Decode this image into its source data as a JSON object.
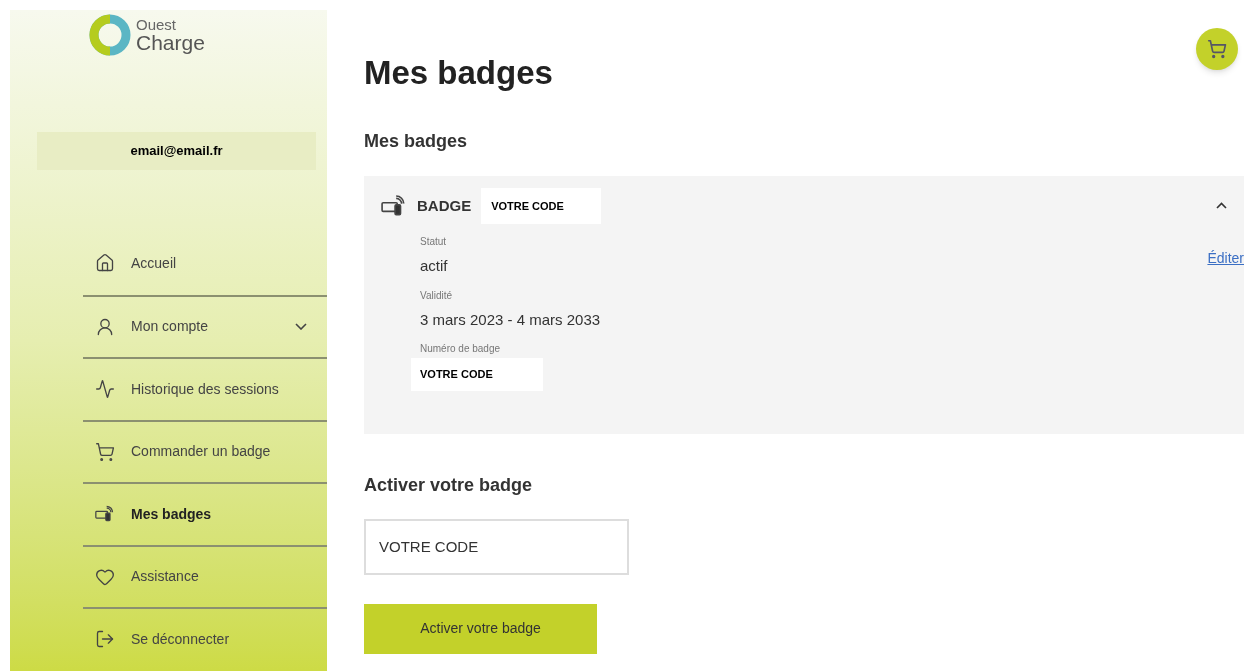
{
  "logo": {
    "line_1": "Ouest",
    "line_2": "Charge"
  },
  "user": {
    "email": "email@email.fr"
  },
  "nav": [
    {
      "label": "Accueil",
      "selected": false,
      "kind": "link"
    },
    {
      "label": "Mon compte",
      "selected": false,
      "kind": "dropdown"
    },
    {
      "label": "Historique des sessions",
      "selected": false,
      "kind": "link"
    },
    {
      "label": "Commander un badge",
      "selected": false,
      "kind": "link"
    },
    {
      "label": "Mes badges",
      "selected": true,
      "kind": "link"
    },
    {
      "label": "Assistance",
      "selected": false,
      "kind": "link"
    },
    {
      "label": "Se déconnecter",
      "selected": false,
      "kind": "link"
    }
  ],
  "page_title": "Mes badges",
  "section_title": "Mes badges",
  "badge": {
    "label": "BADGE",
    "code": "VOTRE CODE",
    "expanded": true,
    "edit_link": "Éditer",
    "fields": [
      {
        "label": "Statut",
        "value": "actif"
      },
      {
        "label": "Validité",
        "value": "3 mars 2023 - 4 mars 2033"
      },
      {
        "label": "Numéro de badge",
        "value": "VOTRE CODE"
      }
    ]
  },
  "activate": {
    "title": "Activer votre badge",
    "input_value": "VOTRE CODE",
    "button": "Activer votre badge"
  }
}
